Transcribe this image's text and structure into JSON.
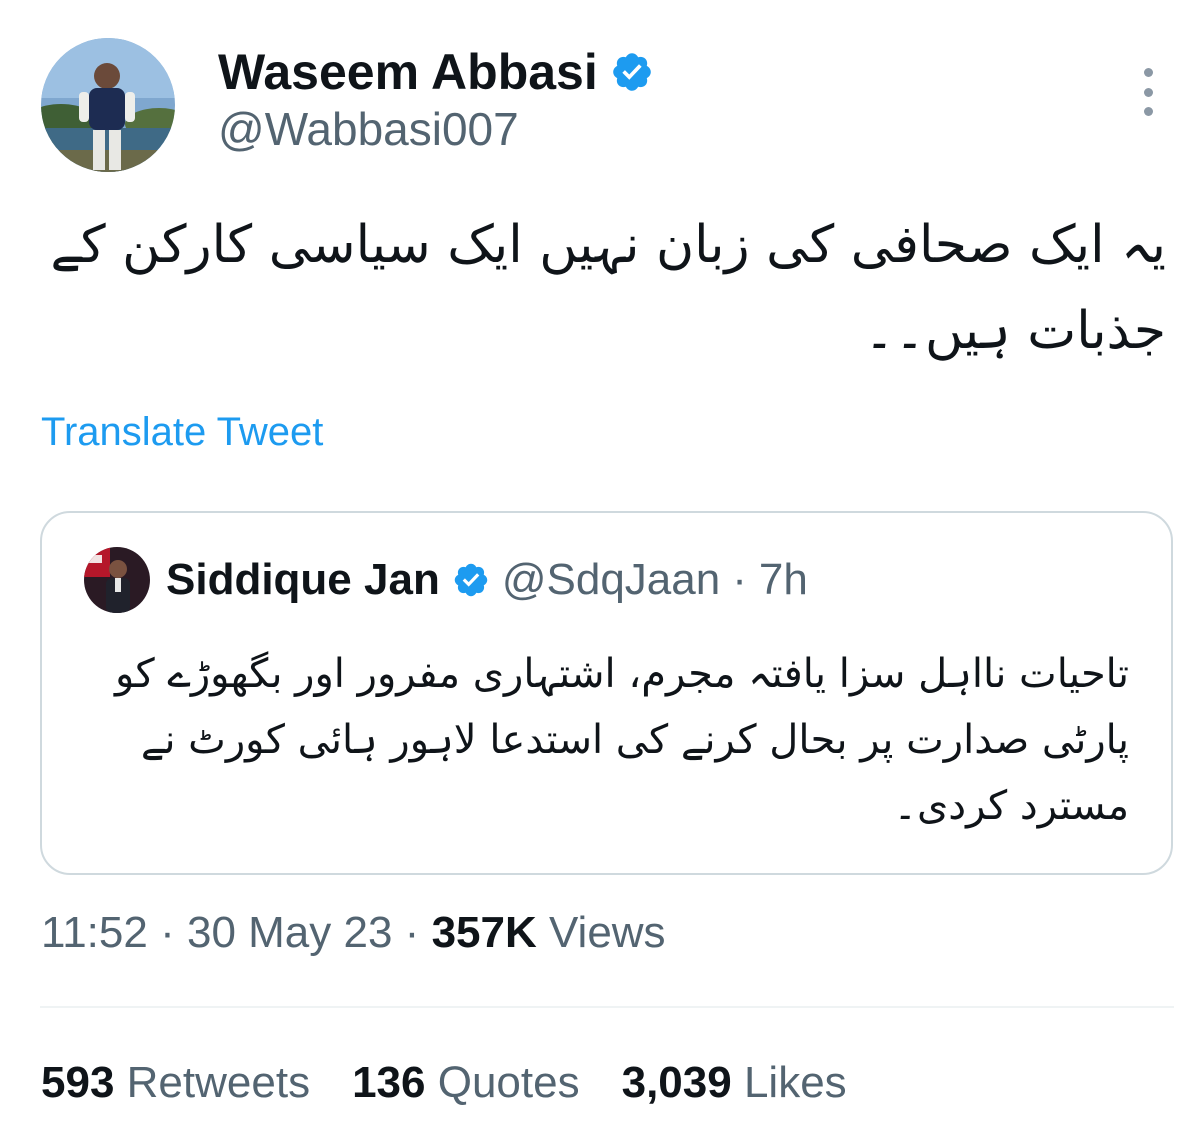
{
  "author": {
    "name": "Waseem Abbasi",
    "handle": "@Wabbasi007",
    "verified": true
  },
  "tweet": {
    "text": "یہ ایک صحافی کی زبان نہیں ایک سیاسی کارکن کے جذبات ہیں۔۔",
    "translate_label": "Translate Tweet"
  },
  "quote": {
    "name": "Siddique Jan",
    "handle": "@SdqJaan",
    "separator": "·",
    "time": "7h",
    "verified": true,
    "text": "تاحیات نااہل سزا یافتہ مجرم، اشتہاری مفرور اور بگھوڑے کو پارٹی صدارت پر بحال کرنے کی استدعا لاہور ہائی کورٹ نے مسترد کردی۔"
  },
  "meta": {
    "time": "11:52",
    "separator": "·",
    "date": "30 May 23",
    "views_count": "357K",
    "views_label": "Views"
  },
  "stats": {
    "retweets_count": "593",
    "retweets_label": "Retweets",
    "quotes_count": "136",
    "quotes_label": "Quotes",
    "likes_count": "3,039",
    "likes_label": "Likes"
  },
  "colors": {
    "link": "#1d9bf0",
    "verified": "#1d9bf0",
    "text_primary": "#0f1419",
    "text_secondary": "#536471",
    "border": "#cfd9de"
  },
  "icons": {
    "verified": "verified-badge-icon",
    "more": "more-options-icon"
  }
}
